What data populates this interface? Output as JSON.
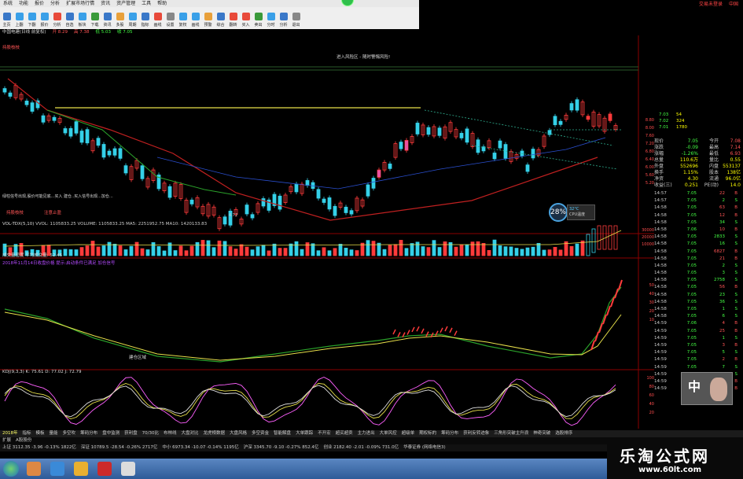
{
  "menu": {
    "items": [
      "系统",
      "功能",
      "报价",
      "分析",
      "扩展市场行情",
      "资讯",
      "资产管理",
      "工具",
      "帮助"
    ],
    "right_links": [
      "交易未登录",
      "中国"
    ]
  },
  "toolbar": {
    "buttons": [
      {
        "label": "主页",
        "icon": "home-icon",
        "color": "#3a78c8"
      },
      {
        "label": "上翻",
        "icon": "up-icon",
        "color": "#3aa0e8"
      },
      {
        "label": "下翻",
        "icon": "down-icon",
        "color": "#3aa0e8"
      },
      {
        "label": "报价",
        "icon": "quote-icon",
        "color": "#3aa0e8"
      },
      {
        "label": "分析",
        "icon": "analysis-icon",
        "color": "#e84a3a"
      },
      {
        "label": "自选",
        "icon": "favorite-icon",
        "color": "#3a78c8"
      },
      {
        "label": "板块",
        "icon": "sector-icon",
        "color": "#3aa0e8"
      },
      {
        "label": "下载",
        "icon": "download-icon",
        "color": "#3a9a3a"
      },
      {
        "label": "资讯",
        "icon": "news-icon",
        "color": "#3a78c8"
      },
      {
        "label": "多股",
        "icon": "multi-icon",
        "color": "#e8a03a"
      },
      {
        "label": "周期",
        "icon": "period-icon",
        "color": "#3aa0e8"
      },
      {
        "label": "指标",
        "icon": "indicator-icon",
        "color": "#3a78c8"
      },
      {
        "label": "画线",
        "icon": "draw-icon",
        "color": "#e84a3a"
      },
      {
        "label": "设置",
        "icon": "settings-icon",
        "color": "#888888"
      },
      {
        "label": "复权",
        "icon": "restore-icon",
        "color": "#3aa0e8"
      },
      {
        "label": "画线",
        "icon": "pen-icon",
        "color": "#3aa0e8"
      },
      {
        "label": "预警",
        "icon": "alert-icon",
        "color": "#e8a03a"
      },
      {
        "label": "综合",
        "icon": "overview-icon",
        "color": "#3a78c8"
      },
      {
        "label": "翻转",
        "icon": "flip-icon",
        "color": "#e84a3a"
      },
      {
        "label": "买入",
        "icon": "buy-icon",
        "color": "#e84a3a"
      },
      {
        "label": "卖出",
        "icon": "sell-icon",
        "color": "#3a9a3a"
      },
      {
        "label": "分时",
        "icon": "timeshare-icon",
        "color": "#3aa0e8"
      },
      {
        "label": "分析",
        "icon": "chart-icon",
        "color": "#3a78c8"
      },
      {
        "label": "退出",
        "icon": "exit-icon",
        "color": "#888888"
      }
    ]
  },
  "stock_header": {
    "name": "中国电建(日线 前复权)",
    "period": "日线",
    "values": [
      "开 8.29",
      "高 7.38",
      "低 5.03",
      "收 7.05"
    ],
    "note": "进入风险区 - 随时警惕风险!"
  },
  "main_chart": {
    "annotation_left": "持股枝枝",
    "annotation_mid": "注意止盈",
    "annotation_bottom": "绿柱信号出现,股价可能见底...买入 建仓..买入信号出现...加仓...",
    "low_label": "4.72",
    "scale_labels": [
      "8.80",
      "8.00",
      "7.60",
      "7.20",
      "6.80",
      "6.40",
      "6.00",
      "5.60",
      "5.20"
    ]
  },
  "volume_chart": {
    "title": "VOL-TDX(5,10)",
    "values": "VVOL: 1105833.25  VOLUME: 1105833.25  MA5: 2251952.75  MA10: 1420133.83",
    "scale_labels": [
      "30000",
      "20000",
      "10000"
    ]
  },
  "cost_chart": {
    "title": "成交量密度  平均成交量: 52.46",
    "legend": "2018年11月14日收盘价格 提示:启动条件已满足 加仓信号",
    "annotation": "建仓区域",
    "scale_labels": [
      "50",
      "40",
      "30",
      "20",
      "10"
    ]
  },
  "kdj_chart": {
    "title": "KDJ(9,3,3)  K: 75.61  D: 77.02  J: 72.79",
    "scale_labels": [
      "100",
      "80",
      "60",
      "40",
      "20"
    ]
  },
  "right_panel": {
    "top_prices": [
      "7.03",
      "7.02",
      "7.01"
    ],
    "top_vols": [
      "54",
      "324",
      "1780"
    ],
    "stats": [
      {
        "l": "现价",
        "v": "7.05",
        "l2": "今开",
        "v2": "7.08"
      },
      {
        "l": "涨跌",
        "v": "-0.09",
        "l2": "最高",
        "v2": "7.14"
      },
      {
        "l": "涨幅",
        "v": "-1.26%",
        "l2": "最低",
        "v2": "6.93"
      },
      {
        "l": "总量",
        "v": "110.6万",
        "l2": "量比",
        "v2": "0.55"
      },
      {
        "l": "外盘",
        "v": "552696",
        "l2": "内盘",
        "v2": "553137"
      },
      {
        "l": "换手",
        "v": "1.15%",
        "l2": "股本",
        "v2": "138亿"
      },
      {
        "l": "净资",
        "v": "4.30",
        "l2": "流通",
        "v2": "96.0亿"
      },
      {
        "l": "收益(三)",
        "v": "0.251",
        "l2": "PE(动)",
        "v2": "14.0"
      }
    ],
    "ticks": [
      {
        "t": "14:57",
        "p": "7.05",
        "v": "22",
        "s": "B"
      },
      {
        "t": "14:57",
        "p": "7.05",
        "v": "2",
        "s": "S"
      },
      {
        "t": "14:58",
        "p": "7.05",
        "v": "63",
        "s": "B"
      },
      {
        "t": "14:58",
        "p": "7.05",
        "v": "12",
        "s": "B"
      },
      {
        "t": "14:58",
        "p": "7.05",
        "v": "34",
        "s": "S"
      },
      {
        "t": "14:58",
        "p": "7.06",
        "v": "10",
        "s": "B"
      },
      {
        "t": "14:58",
        "p": "7.05",
        "v": "2833",
        "s": "S"
      },
      {
        "t": "14:58",
        "p": "7.05",
        "v": "16",
        "s": "S"
      },
      {
        "t": "14:58",
        "p": "7.05",
        "v": "6827",
        "s": "B"
      },
      {
        "t": "14:58",
        "p": "7.05",
        "v": "21",
        "s": "B"
      },
      {
        "t": "14:58",
        "p": "7.05",
        "v": "2",
        "s": "S"
      },
      {
        "t": "14:58",
        "p": "7.05",
        "v": "3",
        "s": "S"
      },
      {
        "t": "14:58",
        "p": "7.05",
        "v": "2758",
        "s": "S"
      },
      {
        "t": "14:58",
        "p": "7.05",
        "v": "56",
        "s": "B"
      },
      {
        "t": "14:58",
        "p": "7.05",
        "v": "23",
        "s": "S"
      },
      {
        "t": "14:58",
        "p": "7.05",
        "v": "36",
        "s": "S"
      },
      {
        "t": "14:58",
        "p": "7.05",
        "v": "1",
        "s": "S"
      },
      {
        "t": "14:58",
        "p": "7.05",
        "v": "6",
        "s": "S"
      },
      {
        "t": "14:59",
        "p": "7.06",
        "v": "4",
        "s": "B"
      },
      {
        "t": "14:59",
        "p": "7.05",
        "v": "25",
        "s": "B"
      },
      {
        "t": "14:59",
        "p": "7.05",
        "v": "1",
        "s": "S"
      },
      {
        "t": "14:59",
        "p": "7.05",
        "v": "3",
        "s": "B"
      },
      {
        "t": "14:59",
        "p": "7.05",
        "v": "5",
        "s": "S"
      },
      {
        "t": "14:59",
        "p": "7.05",
        "v": "2",
        "s": "B"
      },
      {
        "t": "14:59",
        "p": "7.05",
        "v": "7",
        "s": "S"
      },
      {
        "t": "14:59",
        "p": "7.05",
        "v": "2",
        "s": "S"
      },
      {
        "t": "14:59",
        "p": "7.05",
        "v": "8",
        "s": "B"
      },
      {
        "t": "14:59",
        "p": "7.05",
        "v": "3",
        "s": "B"
      }
    ]
  },
  "bottom_tabs": [
    "指标",
    "模板",
    "量能",
    "多空吹",
    "筹码分布",
    "盘中监测",
    "获利盘",
    "70/30比",
    "布林线",
    "大盘对比",
    "龙虎榜数据",
    "大盘风格",
    "多空资金",
    "智能解盘",
    "大单跟踪",
    "不开宏",
    "超买超卖",
    "主力进出",
    "大单风控",
    "超级单",
    "期权标的",
    "筹码分布",
    "获利反转迹象",
    "三角形突破主升浪",
    "神奇突破",
    "选股排序"
  ],
  "bottom_tab_prefix": "2018年",
  "index_bar": [
    "上证 3112.35 -3.96 -0.13% 1822亿",
    "深证 10789.5 -28.54 -0.26% 2717亿",
    "中小 6973.34 -10.07 -0.14% 1195亿",
    "沪深 3345.70 -9.10 -0.27% 852.4亿",
    "创业 2182.40 -2.01 -0.09% 731.0亿",
    "华泰证券 (网络电信3)"
  ],
  "sub_tabs": [
    "扩展",
    "A股股份"
  ],
  "cpu": {
    "value": "28%",
    "temp": "32°C",
    "label": "CPU温度"
  },
  "brand": {
    "name": "乐淘公式网",
    "url": "www.60lt.com"
  }
}
